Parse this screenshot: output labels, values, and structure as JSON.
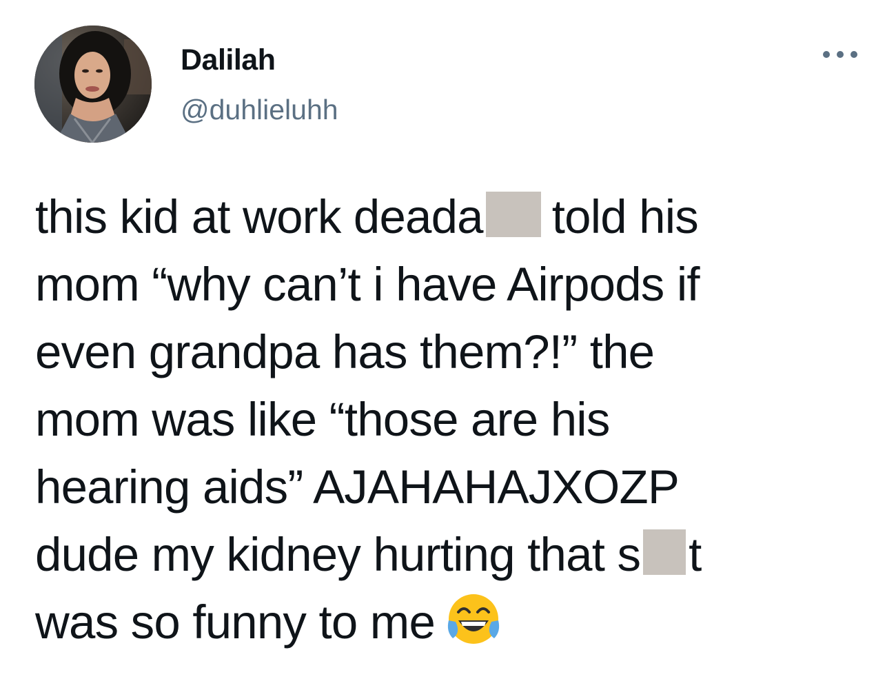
{
  "author": {
    "name": "Dalilah",
    "handle": "@duhlieluhh",
    "avatar_icon": "profile-photo"
  },
  "more_menu": {
    "icon": "more-horizontal-icon"
  },
  "tweet": {
    "lines": [
      {
        "before": "this kid at work deada",
        "after": "told his"
      },
      {
        "text": "mom “why can’t i have Airpods if"
      },
      {
        "text": "even grandpa has them?!” the"
      },
      {
        "text": "mom was like “those are his"
      },
      {
        "text": "hearing aids” AJAHAHAJXOZP"
      },
      {
        "before": "dude my kidney hurting that s",
        "after": "t"
      },
      {
        "text": "was so funny to me"
      }
    ],
    "emoji": "face-with-tears-of-joy",
    "censor_color": "#c8c2bc"
  },
  "colors": {
    "text": "#0f1419",
    "secondary": "#5b7083"
  }
}
